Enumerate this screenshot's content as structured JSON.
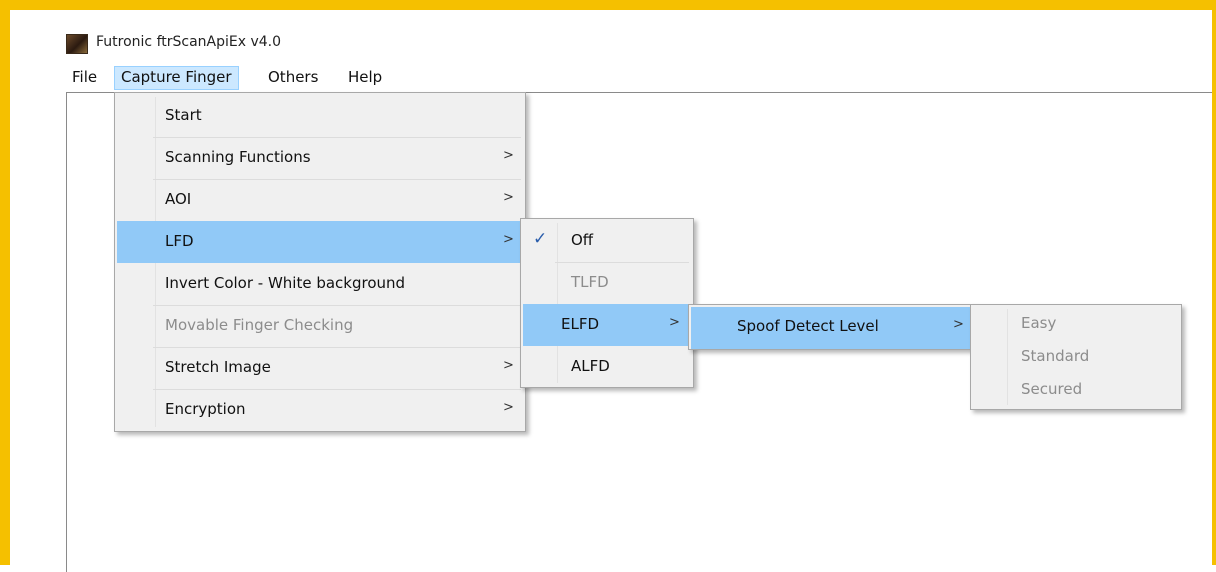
{
  "window": {
    "title": "Futronic ftrScanApiEx v4.0",
    "icon": "fingerprint-app-icon"
  },
  "menubar": {
    "items": [
      {
        "label": "File"
      },
      {
        "label": "Capture Finger",
        "active": true
      },
      {
        "label": "Others"
      },
      {
        "label": "Help"
      }
    ]
  },
  "capture_menu": {
    "items": [
      {
        "label": "Start",
        "submenu": false,
        "enabled": true
      },
      {
        "label": "Scanning Functions",
        "submenu": true,
        "arrow": ">",
        "enabled": true
      },
      {
        "label": "AOI",
        "submenu": true,
        "arrow": ">",
        "enabled": true
      },
      {
        "label": "LFD",
        "submenu": true,
        "arrow": ">",
        "enabled": true,
        "highlighted": true
      },
      {
        "label": "Invert Color - White background",
        "submenu": false,
        "enabled": true
      },
      {
        "label": "Movable Finger Checking",
        "submenu": false,
        "enabled": false
      },
      {
        "label": "Stretch Image",
        "submenu": true,
        "arrow": ">",
        "enabled": true
      },
      {
        "label": "Encryption",
        "submenu": true,
        "arrow": ">",
        "enabled": true
      }
    ]
  },
  "lfd_menu": {
    "items": [
      {
        "label": "Off",
        "checked": true,
        "check_mark": "✓",
        "enabled": true
      },
      {
        "label": "TLFD",
        "enabled": false
      },
      {
        "label": "ELFD",
        "submenu": true,
        "arrow": ">",
        "enabled": true,
        "highlighted": true
      },
      {
        "label": "ALFD",
        "enabled": true
      }
    ]
  },
  "elfd_menu": {
    "items": [
      {
        "label": "Spoof Detect Level",
        "submenu": true,
        "arrow": ">",
        "enabled": true,
        "highlighted": true
      }
    ]
  },
  "spoof_menu": {
    "items": [
      {
        "label": "Easy",
        "enabled": false
      },
      {
        "label": "Standard",
        "enabled": false
      },
      {
        "label": "Secured",
        "enabled": false
      }
    ]
  },
  "colors": {
    "frame": "#f5c000",
    "menu_highlight": "#91c9f7",
    "menubar_active": "#cce8ff",
    "disabled_text": "#8c8c8c"
  }
}
